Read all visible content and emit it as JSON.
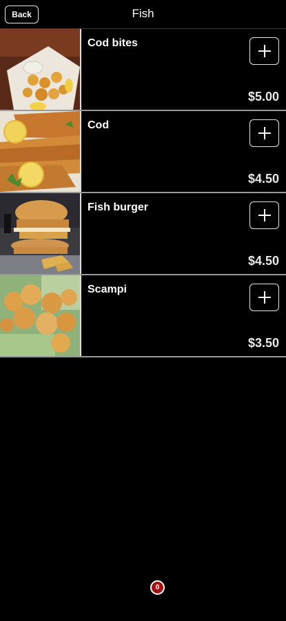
{
  "header": {
    "back_label": "Back",
    "title": "Fish"
  },
  "items": [
    {
      "name": "Cod bites",
      "price": "$5.00",
      "image": "cod-bites-photo"
    },
    {
      "name": "Cod",
      "price": "$4.50",
      "image": "cod-fillet-photo"
    },
    {
      "name": "Fish burger",
      "price": "$4.50",
      "image": "fish-burger-photo"
    },
    {
      "name": "Scampi",
      "price": "$3.50",
      "image": "scampi-photo"
    }
  ],
  "cart": {
    "count": "0"
  },
  "colors": {
    "background": "#000000",
    "badge": "#a31212",
    "border": "#e6e6e6"
  }
}
